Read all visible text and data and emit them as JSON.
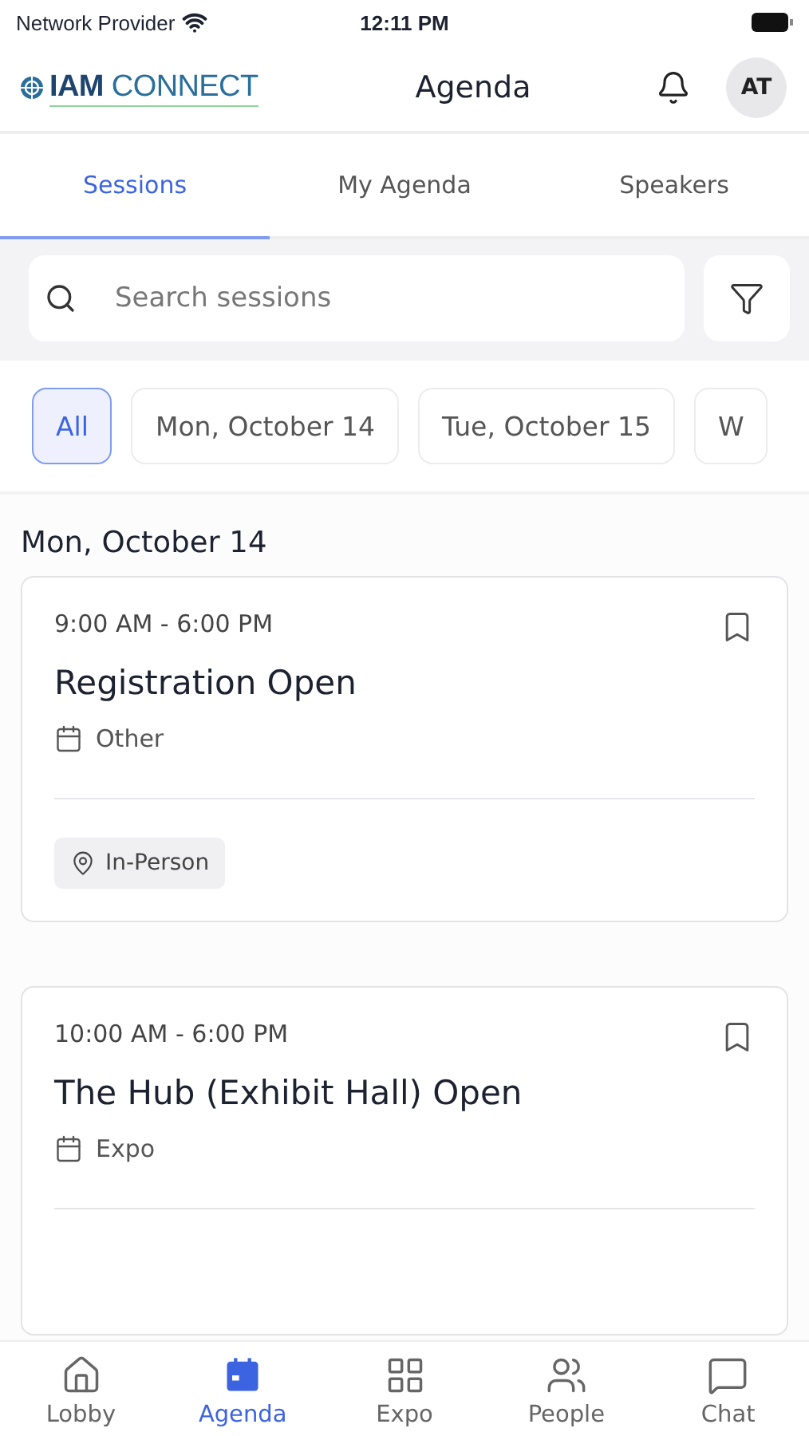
{
  "status_bar": {
    "carrier": "Network Provider",
    "time": "12:11 PM"
  },
  "header": {
    "logo": "**IAM** CONNECT",
    "title": "Agenda",
    "avatar": "AT"
  },
  "tabs": [
    {
      "label": "Sessions",
      "selected": true
    },
    {
      "label": "My Agenda",
      "selected": false
    },
    {
      "label": "Speakers",
      "selected": false
    }
  ],
  "search": {
    "placeholder": "Search sessions"
  },
  "date_filters": [
    {
      "label": "All",
      "selected": true
    },
    {
      "label": "Mon, October 14",
      "selected": false
    },
    {
      "label": "Tue, October 15",
      "selected": false
    },
    {
      "label": "W",
      "selected": false
    }
  ],
  "day_heading": "Mon, October 14",
  "sessions": [
    {
      "time": "9:00 AM - 6:00 PM",
      "title": "Registration Open",
      "category": "Other",
      "bookmarked": false,
      "tag": "In-Person"
    },
    {
      "time": "10:00 AM - 6:00 PM",
      "title": "The Hub (Exhibit Hall) Open",
      "category": "Expo",
      "bookmarked": false
    }
  ],
  "bottom_nav": [
    {
      "label": "Lobby",
      "kind": "home",
      "selected": false
    },
    {
      "label": "Agenda",
      "kind": "calendar",
      "selected": true
    },
    {
      "label": "Expo",
      "kind": "grid",
      "selected": false
    },
    {
      "label": "People",
      "kind": "people",
      "selected": false
    },
    {
      "label": "Chat",
      "kind": "chat",
      "selected": false
    }
  ]
}
